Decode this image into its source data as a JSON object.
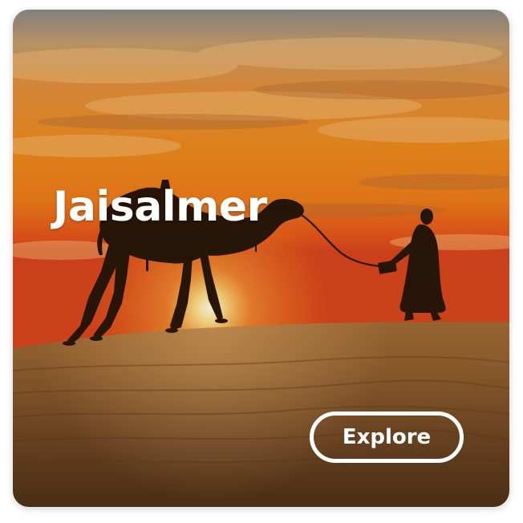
{
  "card": {
    "title": "Jaisalmer",
    "cta_label": "Explore",
    "image_subject": "camel-and-walker-silhouette-desert-sunset"
  },
  "colors": {
    "sky_top": "#7f8e9c",
    "sky_orange": "#e8781c",
    "sun": "#fff3b0",
    "sand": "#8a5a2c",
    "silhouette": "#2a1608",
    "text": "#ffffff"
  }
}
